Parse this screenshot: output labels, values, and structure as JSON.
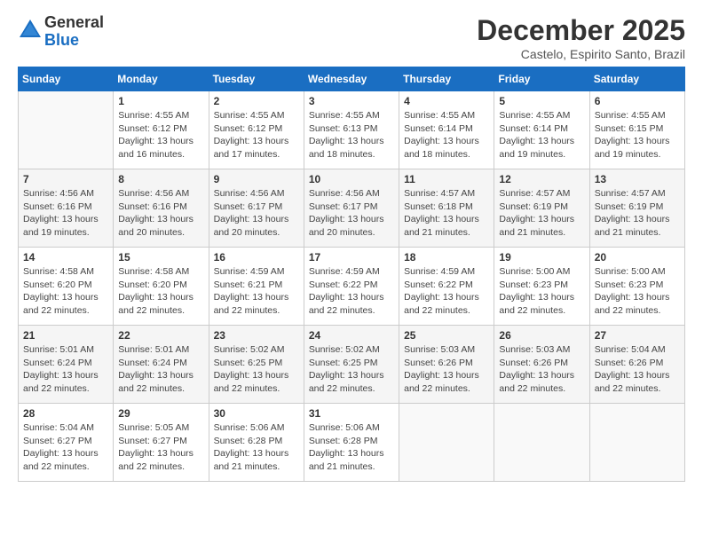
{
  "logo": {
    "line1": "General",
    "line2": "Blue"
  },
  "title": "December 2025",
  "subtitle": "Castelo, Espirito Santo, Brazil",
  "days_of_week": [
    "Sunday",
    "Monday",
    "Tuesday",
    "Wednesday",
    "Thursday",
    "Friday",
    "Saturday"
  ],
  "weeks": [
    [
      {
        "num": "",
        "info": ""
      },
      {
        "num": "1",
        "info": "Sunrise: 4:55 AM\nSunset: 6:12 PM\nDaylight: 13 hours\nand 16 minutes."
      },
      {
        "num": "2",
        "info": "Sunrise: 4:55 AM\nSunset: 6:12 PM\nDaylight: 13 hours\nand 17 minutes."
      },
      {
        "num": "3",
        "info": "Sunrise: 4:55 AM\nSunset: 6:13 PM\nDaylight: 13 hours\nand 18 minutes."
      },
      {
        "num": "4",
        "info": "Sunrise: 4:55 AM\nSunset: 6:14 PM\nDaylight: 13 hours\nand 18 minutes."
      },
      {
        "num": "5",
        "info": "Sunrise: 4:55 AM\nSunset: 6:14 PM\nDaylight: 13 hours\nand 19 minutes."
      },
      {
        "num": "6",
        "info": "Sunrise: 4:55 AM\nSunset: 6:15 PM\nDaylight: 13 hours\nand 19 minutes."
      }
    ],
    [
      {
        "num": "7",
        "info": "Sunrise: 4:56 AM\nSunset: 6:16 PM\nDaylight: 13 hours\nand 19 minutes."
      },
      {
        "num": "8",
        "info": "Sunrise: 4:56 AM\nSunset: 6:16 PM\nDaylight: 13 hours\nand 20 minutes."
      },
      {
        "num": "9",
        "info": "Sunrise: 4:56 AM\nSunset: 6:17 PM\nDaylight: 13 hours\nand 20 minutes."
      },
      {
        "num": "10",
        "info": "Sunrise: 4:56 AM\nSunset: 6:17 PM\nDaylight: 13 hours\nand 20 minutes."
      },
      {
        "num": "11",
        "info": "Sunrise: 4:57 AM\nSunset: 6:18 PM\nDaylight: 13 hours\nand 21 minutes."
      },
      {
        "num": "12",
        "info": "Sunrise: 4:57 AM\nSunset: 6:19 PM\nDaylight: 13 hours\nand 21 minutes."
      },
      {
        "num": "13",
        "info": "Sunrise: 4:57 AM\nSunset: 6:19 PM\nDaylight: 13 hours\nand 21 minutes."
      }
    ],
    [
      {
        "num": "14",
        "info": "Sunrise: 4:58 AM\nSunset: 6:20 PM\nDaylight: 13 hours\nand 22 minutes."
      },
      {
        "num": "15",
        "info": "Sunrise: 4:58 AM\nSunset: 6:20 PM\nDaylight: 13 hours\nand 22 minutes."
      },
      {
        "num": "16",
        "info": "Sunrise: 4:59 AM\nSunset: 6:21 PM\nDaylight: 13 hours\nand 22 minutes."
      },
      {
        "num": "17",
        "info": "Sunrise: 4:59 AM\nSunset: 6:22 PM\nDaylight: 13 hours\nand 22 minutes."
      },
      {
        "num": "18",
        "info": "Sunrise: 4:59 AM\nSunset: 6:22 PM\nDaylight: 13 hours\nand 22 minutes."
      },
      {
        "num": "19",
        "info": "Sunrise: 5:00 AM\nSunset: 6:23 PM\nDaylight: 13 hours\nand 22 minutes."
      },
      {
        "num": "20",
        "info": "Sunrise: 5:00 AM\nSunset: 6:23 PM\nDaylight: 13 hours\nand 22 minutes."
      }
    ],
    [
      {
        "num": "21",
        "info": "Sunrise: 5:01 AM\nSunset: 6:24 PM\nDaylight: 13 hours\nand 22 minutes."
      },
      {
        "num": "22",
        "info": "Sunrise: 5:01 AM\nSunset: 6:24 PM\nDaylight: 13 hours\nand 22 minutes."
      },
      {
        "num": "23",
        "info": "Sunrise: 5:02 AM\nSunset: 6:25 PM\nDaylight: 13 hours\nand 22 minutes."
      },
      {
        "num": "24",
        "info": "Sunrise: 5:02 AM\nSunset: 6:25 PM\nDaylight: 13 hours\nand 22 minutes."
      },
      {
        "num": "25",
        "info": "Sunrise: 5:03 AM\nSunset: 6:26 PM\nDaylight: 13 hours\nand 22 minutes."
      },
      {
        "num": "26",
        "info": "Sunrise: 5:03 AM\nSunset: 6:26 PM\nDaylight: 13 hours\nand 22 minutes."
      },
      {
        "num": "27",
        "info": "Sunrise: 5:04 AM\nSunset: 6:26 PM\nDaylight: 13 hours\nand 22 minutes."
      }
    ],
    [
      {
        "num": "28",
        "info": "Sunrise: 5:04 AM\nSunset: 6:27 PM\nDaylight: 13 hours\nand 22 minutes."
      },
      {
        "num": "29",
        "info": "Sunrise: 5:05 AM\nSunset: 6:27 PM\nDaylight: 13 hours\nand 22 minutes."
      },
      {
        "num": "30",
        "info": "Sunrise: 5:06 AM\nSunset: 6:28 PM\nDaylight: 13 hours\nand 21 minutes."
      },
      {
        "num": "31",
        "info": "Sunrise: 5:06 AM\nSunset: 6:28 PM\nDaylight: 13 hours\nand 21 minutes."
      },
      {
        "num": "",
        "info": ""
      },
      {
        "num": "",
        "info": ""
      },
      {
        "num": "",
        "info": ""
      }
    ]
  ]
}
